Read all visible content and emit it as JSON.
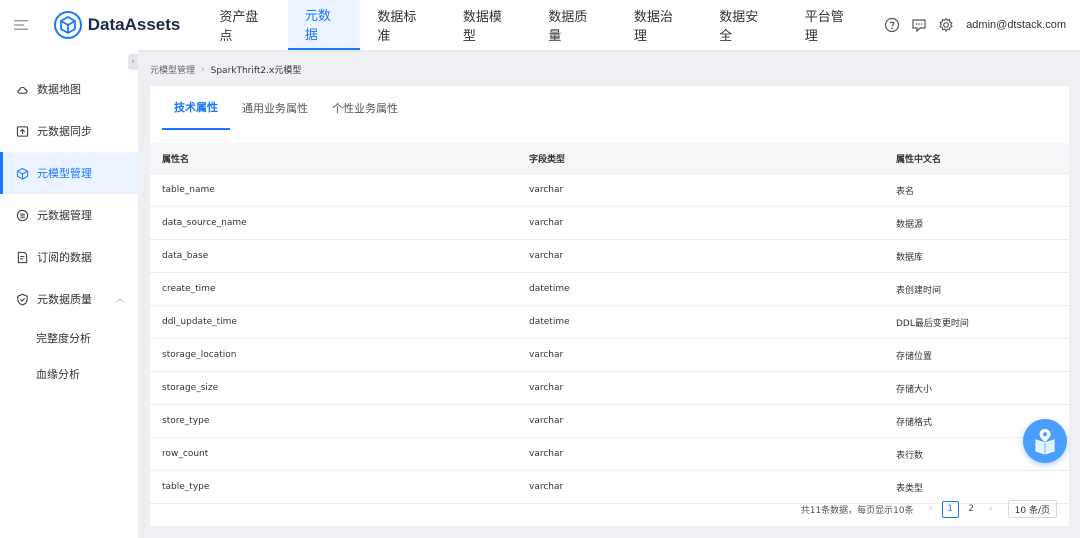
{
  "header": {
    "app_name": "DataAssets",
    "nav": [
      "资产盘点",
      "元数据",
      "数据标准",
      "数据模型",
      "数据质量",
      "数据治理",
      "数据安全",
      "平台管理"
    ],
    "active_nav": 1,
    "user": "admin@dtstack.com"
  },
  "sidebar": {
    "items": [
      "数据地图",
      "元数据同步",
      "元模型管理",
      "元数据管理",
      "订阅的数据",
      "元数据质量"
    ],
    "active": 2,
    "subitems": [
      "完整度分析",
      "血缘分析"
    ]
  },
  "breadcrumb": {
    "parent": "元模型管理",
    "current": "SparkThrift2.x元模型"
  },
  "tabs": [
    "技术属性",
    "通用业务属性",
    "个性业务属性"
  ],
  "table": {
    "columns": [
      "属性名",
      "字段类型",
      "属性中文名"
    ],
    "rows": [
      [
        "table_name",
        "varchar",
        "表名"
      ],
      [
        "data_source_name",
        "varchar",
        "数据源"
      ],
      [
        "data_base",
        "varchar",
        "数据库"
      ],
      [
        "create_time",
        "datetime",
        "表创建时间"
      ],
      [
        "ddl_update_time",
        "datetime",
        "DDL最后变更时间"
      ],
      [
        "storage_location",
        "varchar",
        "存储位置"
      ],
      [
        "storage_size",
        "varchar",
        "存储大小"
      ],
      [
        "store_type",
        "varchar",
        "存储格式"
      ],
      [
        "row_count",
        "varchar",
        "表行数"
      ],
      [
        "table_type",
        "varchar",
        "表类型"
      ]
    ]
  },
  "pagination": {
    "total_text": "共11条数据，每页显示10条",
    "pages": [
      "1",
      "2"
    ],
    "current_page": "1",
    "page_size": "10 条/页"
  },
  "colors": {
    "accent": "#1a78ff",
    "active_bg": "#eaf3ff",
    "page_bg": "#eef0f4"
  }
}
